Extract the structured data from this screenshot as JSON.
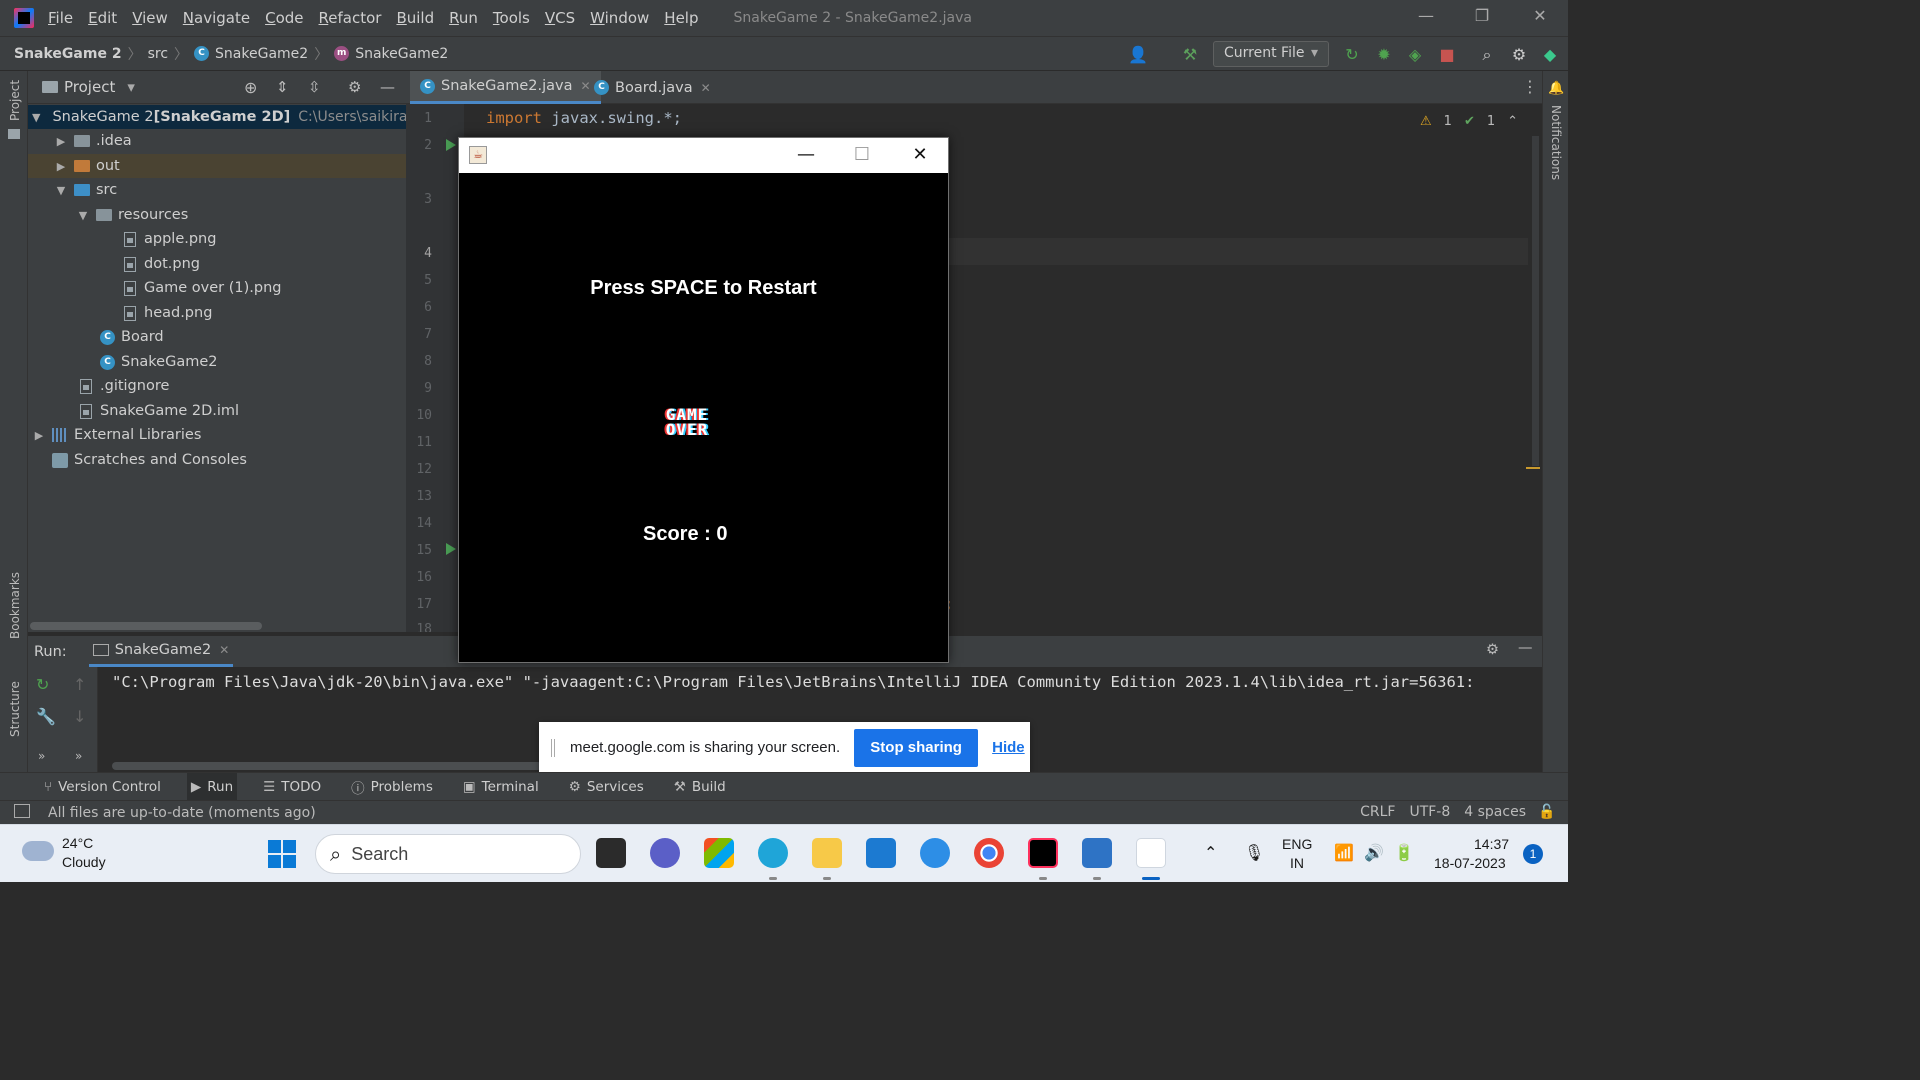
{
  "menubar": {
    "items": [
      "File",
      "Edit",
      "View",
      "Navigate",
      "Code",
      "Refactor",
      "Build",
      "Run",
      "Tools",
      "VCS",
      "Window",
      "Help"
    ],
    "window_title": "SnakeGame 2 - SnakeGame2.java"
  },
  "navbar": {
    "project": "SnakeGame 2",
    "crumb_src": "src",
    "crumb_class": "SnakeGame2",
    "crumb_method": "SnakeGame2",
    "run_config": "Current File"
  },
  "left_strip": {
    "project_label": "Project",
    "bookmarks_label": "Bookmarks",
    "structure_label": "Structure"
  },
  "right_strip": {
    "notifications_label": "Notifications"
  },
  "project_panel": {
    "title": "Project",
    "tree": [
      {
        "label": "SnakeGame 2",
        "bold": " [SnakeGame 2D]",
        "hint": "C:\\Users\\saikiran"
      },
      {
        "label": ".idea"
      },
      {
        "label": "out"
      },
      {
        "label": "src"
      },
      {
        "label": "resources"
      },
      {
        "label": "apple.png"
      },
      {
        "label": "dot.png"
      },
      {
        "label": "Game over (1).png"
      },
      {
        "label": "head.png"
      },
      {
        "label": "Board"
      },
      {
        "label": "SnakeGame2"
      },
      {
        "label": ".gitignore"
      },
      {
        "label": "SnakeGame 2D.iml"
      },
      {
        "label": "External Libraries"
      },
      {
        "label": "Scratches and Consoles"
      }
    ]
  },
  "editor": {
    "tabs": [
      {
        "label": "SnakeGame2.java",
        "active": true
      },
      {
        "label": "Board.java",
        "active": false
      }
    ],
    "line_numbers": [
      "1",
      "2",
      "3",
      "4",
      "5",
      "6",
      "7",
      "8",
      "9",
      "10",
      "11",
      "12",
      "13",
      "14",
      "15",
      "16",
      "17",
      "18"
    ],
    "code_keyword": "import",
    "code_rest": " javax.swing.*;",
    "semicolon_tail": ";",
    "warnings": "1",
    "checks": "1"
  },
  "game_window": {
    "restart_text": "Press SPACE to Restart",
    "gameover_line1": "GAME",
    "gameover_line2": "OVER",
    "score_text": "Score : 0"
  },
  "run_panel": {
    "label": "Run:",
    "tab": "SnakeGame2",
    "console": "\"C:\\Program Files\\Java\\jdk-20\\bin\\java.exe\" \"-javaagent:C:\\Program Files\\JetBrains\\IntelliJ IDEA Community Edition 2023.1.4\\lib\\idea_rt.jar=56361:"
  },
  "share_bar": {
    "message": "meet.google.com is sharing your screen.",
    "stop_label": "Stop sharing",
    "hide_label": "Hide"
  },
  "bottom_tabs": [
    "Version Control",
    "Run",
    "TODO",
    "Problems",
    "Terminal",
    "Services",
    "Build"
  ],
  "status_bar": {
    "message": "All files are up-to-date (moments ago)",
    "line_sep": "CRLF",
    "encoding": "UTF-8",
    "indent": "4 spaces"
  },
  "taskbar": {
    "temperature": "24°C",
    "weather": "Cloudy",
    "search_label": "Search",
    "lang1": "ENG",
    "lang2": "IN",
    "time": "14:37",
    "date": "18-07-2023",
    "notif_count": "1"
  }
}
